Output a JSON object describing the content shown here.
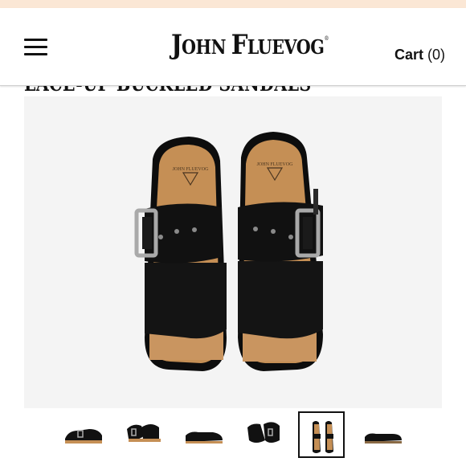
{
  "header": {
    "menu_icon": "hamburger-menu-icon",
    "logo": {
      "part1_big": "J",
      "part1_small": "OHN ",
      "part2_big": "F",
      "part2_small": "LUEVOG",
      "reg": "®"
    },
    "cart_label": "Cart",
    "cart_count": "(0)"
  },
  "product": {
    "title": "LACE-UP BUCKLED SANDALS",
    "main_image_alt": "Black leather sandals with silver buckles and cork footbed, top view"
  },
  "gallery": {
    "thumbnails": [
      {
        "alt": "Side view of sandal"
      },
      {
        "alt": "Pair of sandals angled view"
      },
      {
        "alt": "Single sandal side view"
      },
      {
        "alt": "Sandals front angled view"
      },
      {
        "alt": "Sandals top view",
        "selected": true
      },
      {
        "alt": "Sandal side profile"
      }
    ]
  },
  "colors": {
    "leather": "#121212",
    "cork": "#c58f55",
    "buckle": "#a9a9a9",
    "promo": "#fbe7d5"
  }
}
